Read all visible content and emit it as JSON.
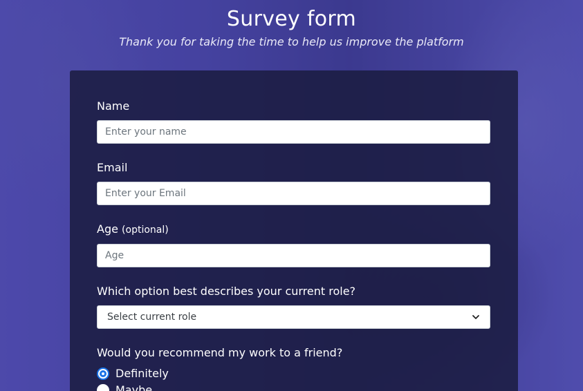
{
  "header": {
    "title": "Survey form",
    "description": "Thank you for taking the time to help us improve the platform"
  },
  "form": {
    "name": {
      "label": "Name",
      "placeholder": "Enter your name",
      "value": ""
    },
    "email": {
      "label": "Email",
      "placeholder": "Enter your Email",
      "value": ""
    },
    "age": {
      "label": "Age",
      "label_hint": "(optional)",
      "placeholder": "Age",
      "value": ""
    },
    "role": {
      "label": "Which option best describes your current role?",
      "selected": "Select current role"
    },
    "recommend": {
      "label": "Would you recommend my work to a friend?",
      "options": [
        {
          "label": "Definitely",
          "checked": true
        },
        {
          "label": "Maybe",
          "checked": false
        }
      ]
    }
  },
  "colors": {
    "background": "#4b4a9e",
    "card": "#1b1c40",
    "accent": "#1a73e8"
  }
}
